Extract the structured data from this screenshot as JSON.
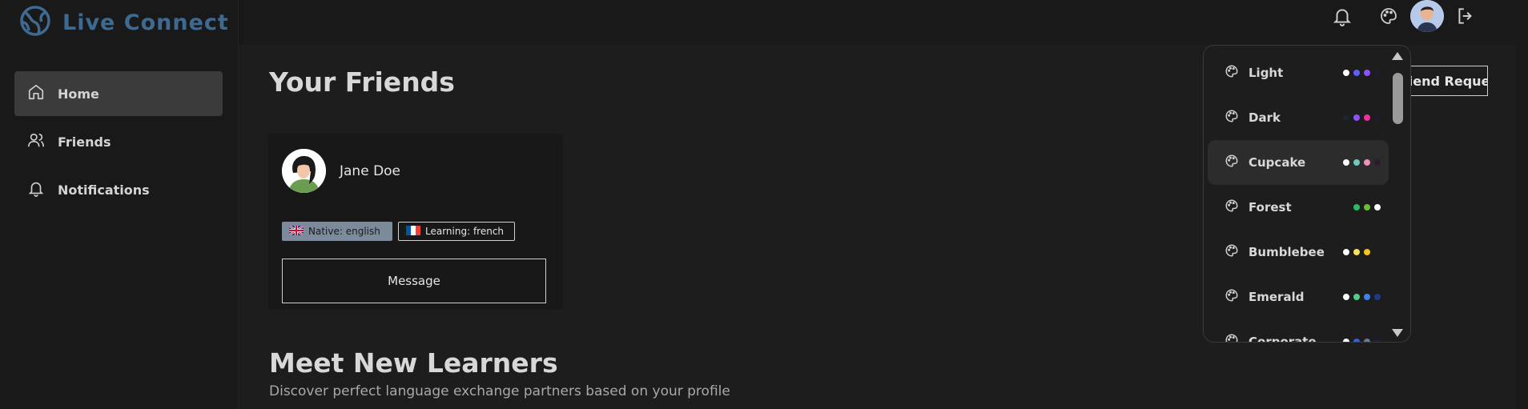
{
  "app": {
    "name": "Live Connect"
  },
  "sidebar": {
    "items": [
      {
        "label": "Home",
        "icon": "home-icon",
        "active": true
      },
      {
        "label": "Friends",
        "icon": "users-icon",
        "active": false
      },
      {
        "label": "Notifications",
        "icon": "bell-icon",
        "active": false
      }
    ]
  },
  "header": {
    "icons": [
      "bell-icon",
      "palette-icon",
      "avatar",
      "logout-icon"
    ]
  },
  "main": {
    "friends_title": "Your Friends",
    "friend_requests_label": "Friend Requests",
    "friends": [
      {
        "name": "Jane Doe",
        "native": "Native: english",
        "learning": "Learning: french",
        "message_label": "Message"
      }
    ],
    "meet_title": "Meet New Learners",
    "meet_subtitle": "Discover perfect language exchange partners based on your profile"
  },
  "themes": {
    "selected": "Cupcake",
    "items": [
      {
        "name": "Light",
        "colors": [
          "#ffffff",
          "#605dff",
          "#8e51ff",
          "#1d1d2b"
        ]
      },
      {
        "name": "Dark",
        "colors": [
          "#1f2433",
          "#8e51ff",
          "#f43098",
          "#1d1d2b"
        ]
      },
      {
        "name": "Cupcake",
        "colors": [
          "#ffffff",
          "#6fc9c1",
          "#f291b6",
          "#2b1c2b"
        ]
      },
      {
        "name": "Forest",
        "colors": [
          "#1d1d1d",
          "#2bb868",
          "#6bbf2d",
          "#ffffff"
        ]
      },
      {
        "name": "Bumblebee",
        "colors": [
          "#ffffff",
          "#f7e35a",
          "#f5c518",
          "#1d1d1d"
        ]
      },
      {
        "name": "Emerald",
        "colors": [
          "#ffffff",
          "#4fcf8a",
          "#3b82f6",
          "#1e3a8a"
        ]
      },
      {
        "name": "Corporate",
        "colors": [
          "#ffffff",
          "#3b5bdb",
          "#6b7a90",
          "#1d2233"
        ]
      }
    ]
  },
  "colors": {
    "brand": "#3e6a92",
    "background": "#1d1d1d",
    "panel": "#181818"
  }
}
